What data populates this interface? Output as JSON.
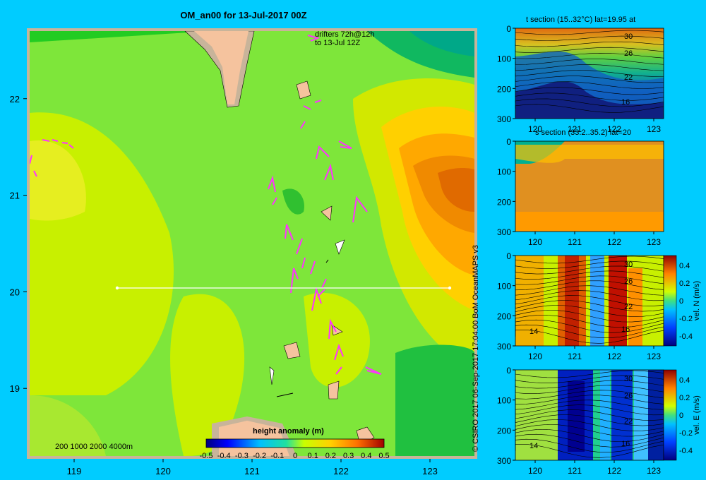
{
  "title": "OM_an00 for 13-Jul-2017 00Z",
  "credit": "© CSIRO 2017   06-Sep-2017 17:04:00 BoM OceanMAPS v3",
  "map": {
    "drifter_note": [
      "drifters 72h@12h",
      "to 13-Jul 12Z"
    ],
    "bathymetry_legend": "200  1000  2000  4000m",
    "colorbar_label": "height anomaly (m)",
    "colorbar_ticks": [
      "-0.5",
      "-0.4",
      "-0.3",
      "-0.2",
      "-0.1",
      "0",
      "0.1",
      "0.2",
      "0.3",
      "0.4",
      "0.5"
    ],
    "colors": {
      "background": "#00ccff",
      "land": "#f5c39e",
      "frame": "#c8b49a",
      "drifter": "#ff33ff"
    }
  },
  "chart_data": [
    {
      "type": "heatmap",
      "title": "OM_an00 for 13-Jul-2017 00Z",
      "variable": "height anomaly (m)",
      "x_ticks": [
        119,
        120,
        121,
        122,
        123
      ],
      "y_ticks": [
        19,
        20,
        21,
        22
      ],
      "xlim": [
        118.5,
        123.5
      ],
      "ylim": [
        18.3,
        22.7
      ],
      "color_range": [
        -0.5,
        0.5
      ],
      "section_line": {
        "lat": 20,
        "lon": [
          119.5,
          123.2
        ]
      },
      "features": [
        {
          "desc": "warm eddy",
          "lon": 123.3,
          "lat": 21.2,
          "value": 0.4
        },
        {
          "desc": "band",
          "lon": 121.5,
          "lat": 21.0,
          "value": 0.05
        }
      ]
    },
    {
      "type": "heatmap",
      "title": "t section (15..32°C) lat=19.95 at",
      "x_ticks": [
        120,
        121,
        122,
        123
      ],
      "y_ticks": [
        0,
        100,
        200,
        300
      ],
      "contour_labels": [
        "30",
        "26",
        "22",
        "16"
      ]
    },
    {
      "type": "heatmap",
      "title": "s section (33.2..35.2) lat=20",
      "x_ticks": [
        120,
        121,
        122,
        123
      ],
      "y_ticks": [
        0,
        100,
        200,
        300
      ]
    },
    {
      "type": "heatmap",
      "title": "vel. N (m/s)",
      "x_ticks": [
        120,
        121,
        122,
        123
      ],
      "y_ticks": [
        0,
        100,
        200,
        300
      ],
      "contour_labels": [
        "30",
        "26",
        "22",
        "16",
        "14"
      ],
      "colorbar_ticks": [
        "0.4",
        "0.2",
        "0",
        "-0.2",
        "-0.4"
      ]
    },
    {
      "type": "heatmap",
      "title": "vel. E (m/s)",
      "x_ticks": [
        120,
        121,
        122,
        123
      ],
      "y_ticks": [
        0,
        100,
        200,
        300
      ],
      "contour_labels": [
        "30",
        "26",
        "22",
        "16",
        "14"
      ],
      "colorbar_ticks": [
        "0.4",
        "0.2",
        "0",
        "-0.2",
        "-0.4"
      ]
    }
  ]
}
